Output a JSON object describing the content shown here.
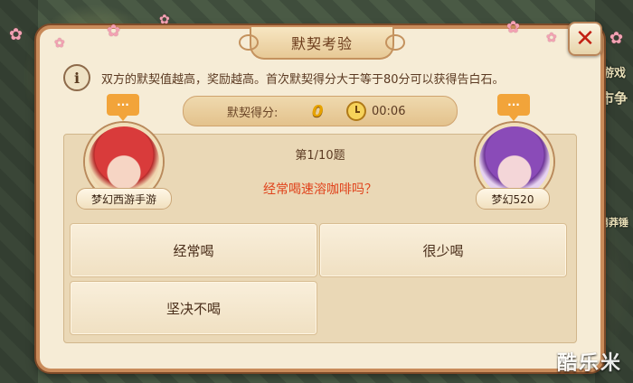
{
  "dialog": {
    "title": "默契考验",
    "close_symbol": "✕",
    "info_text": "双方的默契值越高，奖励越高。首次默契得分大于等于80分可以获得告白石。",
    "score_label": "默契得分:",
    "score_value": "0",
    "timer": "00:06"
  },
  "players": {
    "left": {
      "name": "梦幻西游手游",
      "bubble": "···"
    },
    "right": {
      "name": "梦幻520",
      "bubble": "···"
    }
  },
  "question": {
    "progress": "第1/10题",
    "text": "经常喝速溶咖啡吗？"
  },
  "answers": [
    {
      "label": "经常喝"
    },
    {
      "label": "很少喝"
    },
    {
      "label": "坚决不喝"
    }
  ],
  "background_text": {
    "right_top": "游戏",
    "right_mid": "市争",
    "right_low": "霸莽锤"
  },
  "watermark": "酷乐米",
  "icons": {
    "info": "info-icon",
    "clock": "clock-icon",
    "close": "close-icon"
  },
  "colors": {
    "accent_score": "#e6a200",
    "question_text": "#e0431c",
    "close_x": "#c21f12"
  }
}
